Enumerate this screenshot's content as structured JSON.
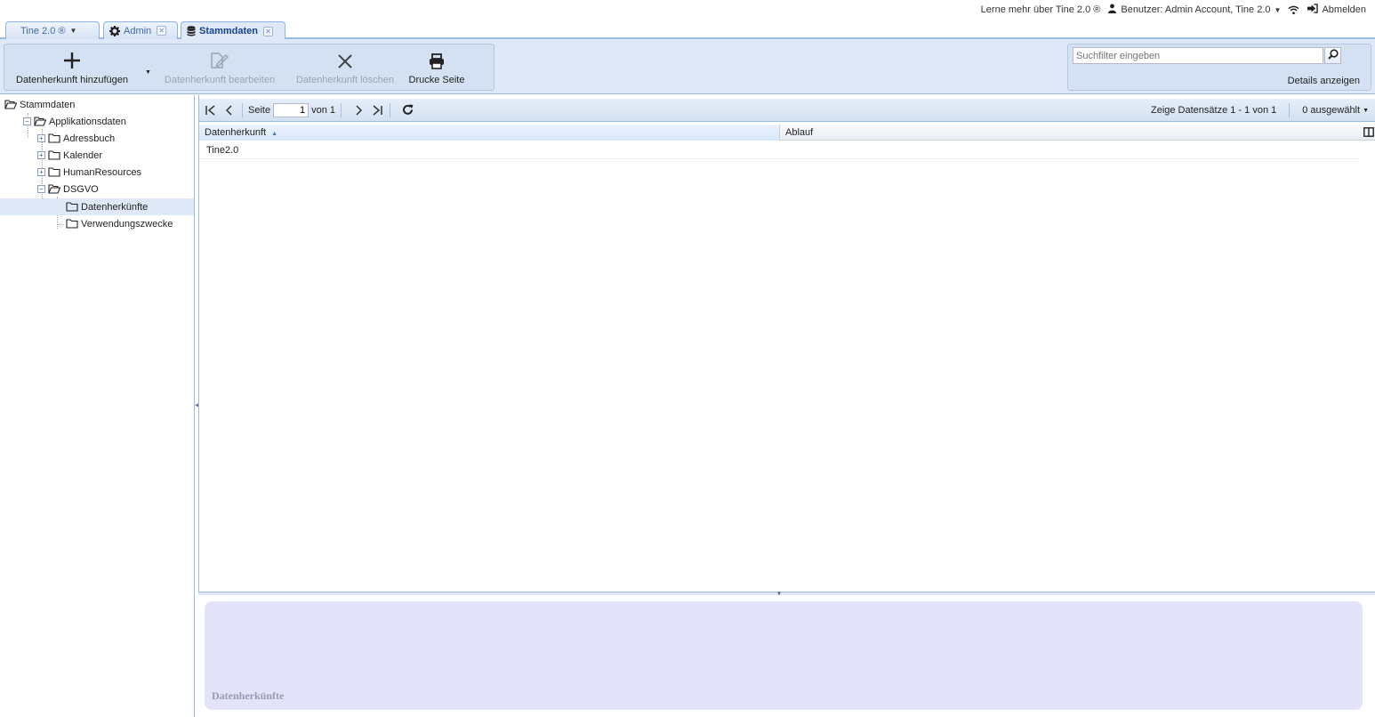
{
  "topbar": {
    "learn_more": "Lerne mehr über Tine 2.0 ®",
    "user": "Benutzer: Admin Account, Tine 2.0",
    "logout": "Abmelden"
  },
  "tabs": [
    {
      "label": "Tine 2.0 ®"
    },
    {
      "label": "Admin"
    },
    {
      "label": "Stammdaten"
    }
  ],
  "toolbar": {
    "add": "Datenherkunft hinzufügen",
    "edit": "Datenherkunft bearbeiten",
    "delete": "Datenherkunft löschen",
    "print": "Drucke Seite",
    "search_placeholder": "Suchfilter eingeben",
    "details": "Details anzeigen"
  },
  "tree": {
    "root": "Stammdaten",
    "app_data": "Applikationsdaten",
    "addressbook": "Adressbuch",
    "calendar": "Kalender",
    "hr": "HumanResources",
    "dsgvo": "DSGVO",
    "data_sources": "Datenherkünfte",
    "purposes": "Verwendungszwecke"
  },
  "pager": {
    "page_label": "Seite",
    "page_value": "1",
    "of_label": "von 1",
    "display_info": "Zeige Datensätze 1 - 1 von 1",
    "selected": "0 ausgewählt"
  },
  "grid": {
    "columns": [
      "Datenherkunft",
      "Ablauf"
    ],
    "rows": [
      {
        "name": "Tine2.0",
        "expiry": ""
      }
    ]
  },
  "detail": {
    "title": "Datenherkünfte"
  }
}
